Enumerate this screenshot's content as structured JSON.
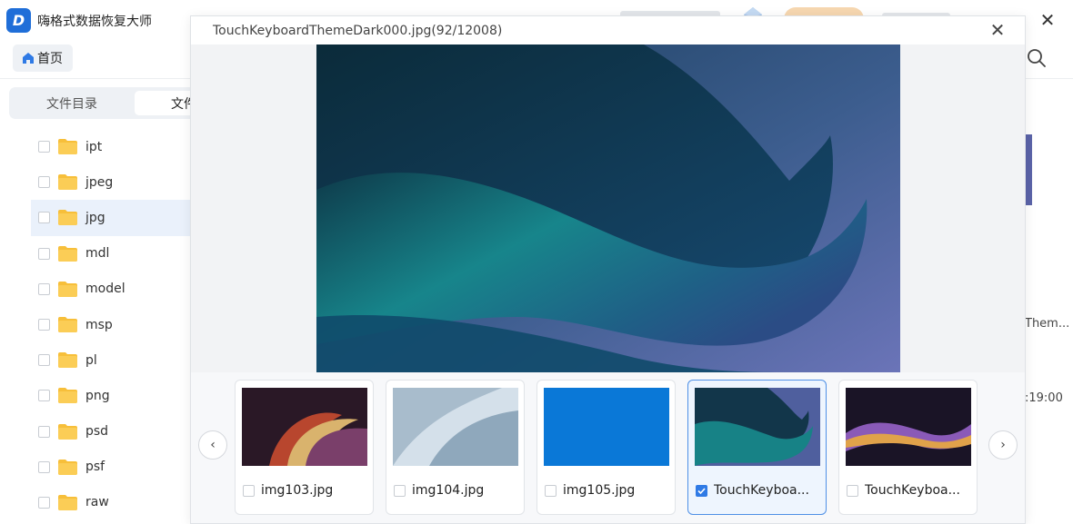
{
  "app": {
    "name": "嗨格式数据恢复大师",
    "logo_icon": "app-logo-icon",
    "home_label": "首页",
    "tabs": [
      "文件目录",
      "文件"
    ],
    "right_partial_text_1": "Them...",
    "right_partial_text_2": ":19:00"
  },
  "tree": [
    {
      "label": "ipt",
      "selected": false
    },
    {
      "label": "jpeg",
      "selected": false
    },
    {
      "label": "jpg",
      "selected": true
    },
    {
      "label": "mdl",
      "selected": false
    },
    {
      "label": "model",
      "selected": false
    },
    {
      "label": "msp",
      "selected": false
    },
    {
      "label": "pl",
      "selected": false
    },
    {
      "label": "png",
      "selected": false
    },
    {
      "label": "psd",
      "selected": false
    },
    {
      "label": "psf",
      "selected": false
    },
    {
      "label": "raw",
      "selected": false
    }
  ],
  "preview": {
    "title": "TouchKeyboardThemeDark000.jpg(92/12008)",
    "close_icon": "close-icon",
    "prev_icon": "chevron-left-icon",
    "next_icon": "chevron-right-icon",
    "thumbnails": [
      {
        "label": "img103.jpg",
        "checked": false,
        "active": false
      },
      {
        "label": "img104.jpg",
        "checked": false,
        "active": false
      },
      {
        "label": "img105.jpg",
        "checked": false,
        "active": false
      },
      {
        "label": "TouchKeyboa...",
        "checked": true,
        "active": true
      },
      {
        "label": "TouchKeyboa...",
        "checked": false,
        "active": false
      }
    ]
  },
  "colors": {
    "accent": "#2f7ae5",
    "selected_row": "#eaf1fb",
    "folder": "#f7bf3a"
  }
}
